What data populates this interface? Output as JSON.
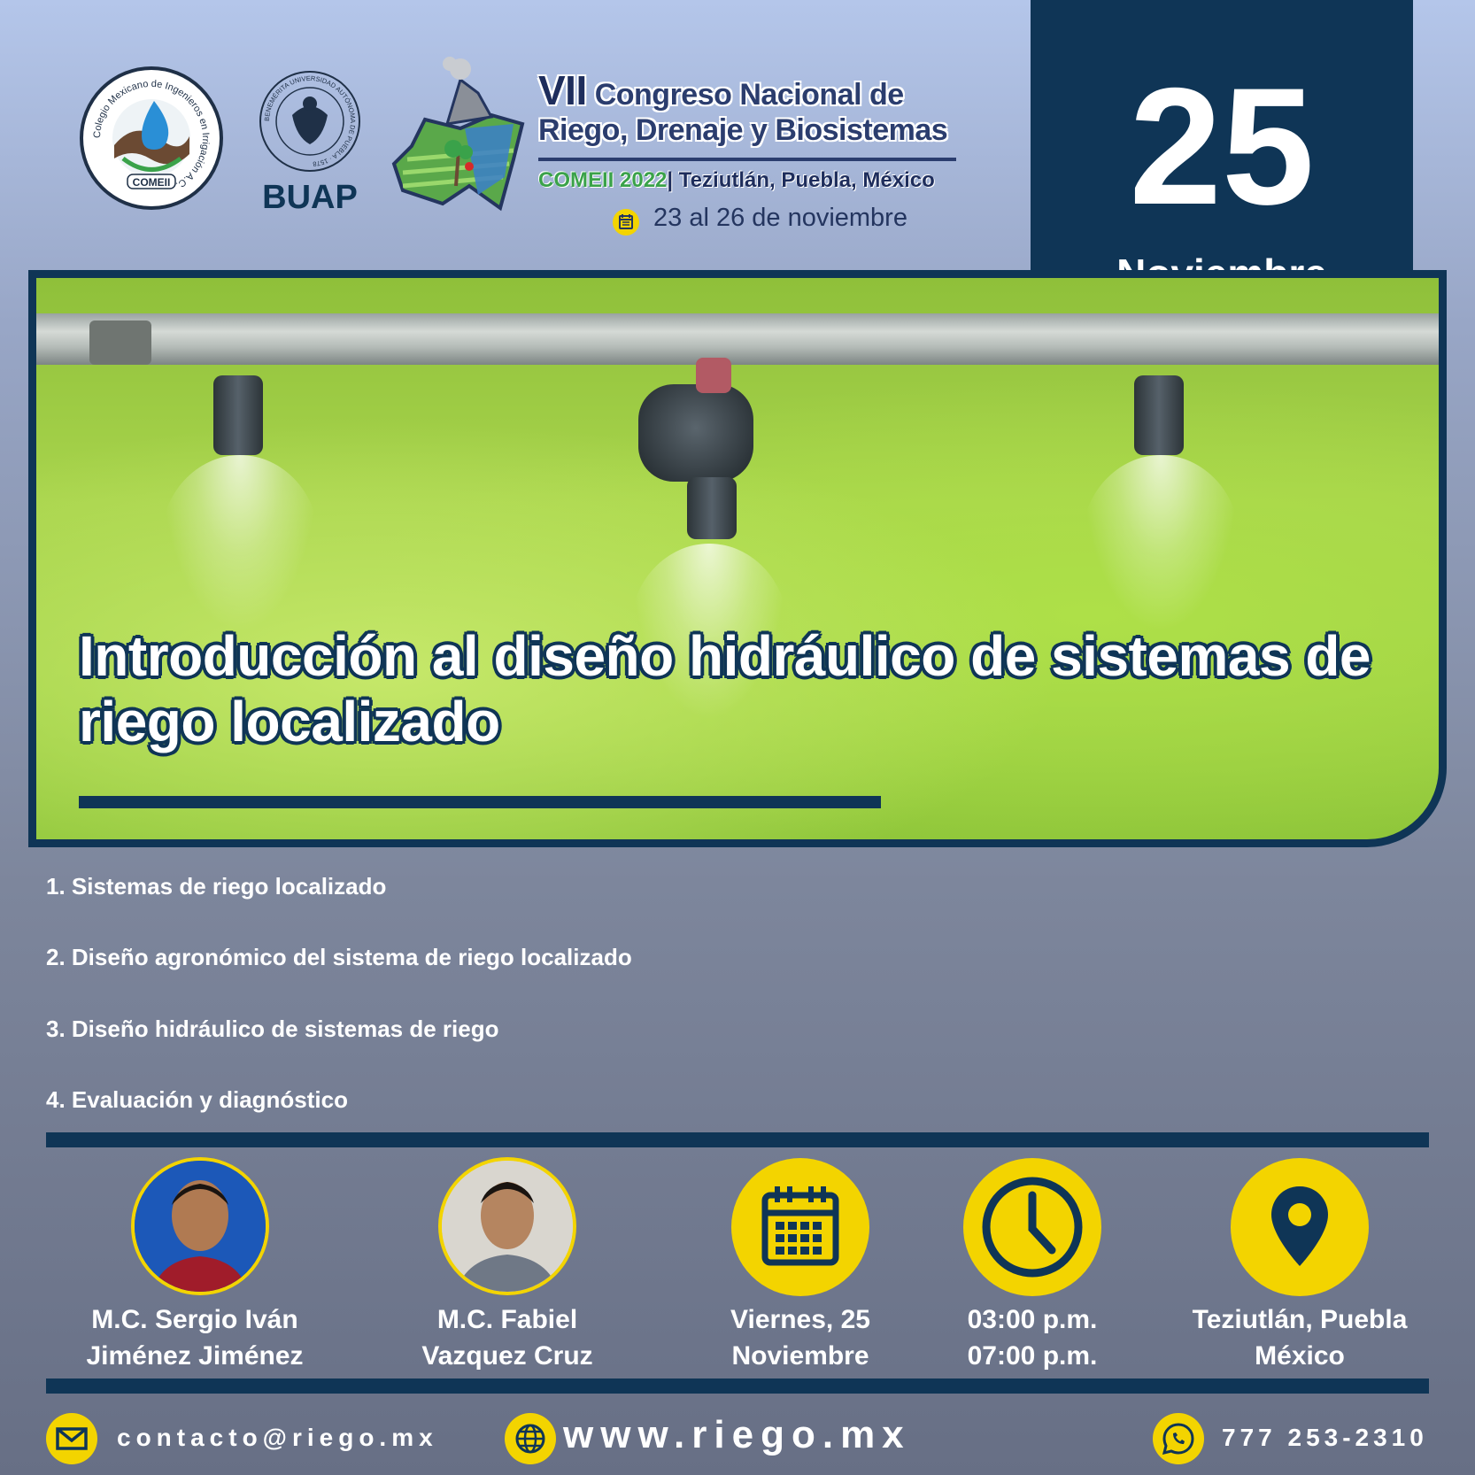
{
  "header": {
    "comeii_logo": {
      "ring_text": "Colegio Mexicano de Ingenieros en Irrigación A.C.",
      "label": "COMEII"
    },
    "buap_logo": {
      "ring_text": "BENEMÉRITA UNIVERSIDAD AUTÓNOMA DE PUEBLA · 1578",
      "label": "BUAP"
    },
    "congress": {
      "edition": "VII",
      "title_line1": "Congreso Nacional de",
      "title_line2": "Riego, Drenaje y Biosistemas",
      "edition_label": "COMEII 2022",
      "separator": "|",
      "place": "Teziutlán, Puebla, México",
      "dates": "23 al 26 de noviembre"
    }
  },
  "banner": {
    "day": "25",
    "month": "Noviembre"
  },
  "course": {
    "title_line1": "Introducción al diseño hidráulico de sistemas de",
    "title_line2": "riego localizado"
  },
  "topics": [
    "1. Sistemas de riego localizado",
    "2. Diseño agronómico del sistema de riego localizado",
    "3. Diseño hidráulico de sistemas de riego",
    "4. Evaluación y diagnóstico"
  ],
  "speakers": [
    {
      "line1": "M.C. Sergio Iván",
      "line2": "Jiménez Jiménez"
    },
    {
      "line1": "M.C. Fabiel",
      "line2": "Vazquez Cruz"
    }
  ],
  "details": {
    "date": {
      "line1": "Viernes, 25",
      "line2": "Noviembre"
    },
    "time": {
      "line1": "03:00 p.m.",
      "line2": "07:00 p.m."
    },
    "location": {
      "line1": "Teziutlán, Puebla",
      "line2": "México"
    }
  },
  "footer": {
    "email": "contacto@riego.mx",
    "website": "www.riego.mx",
    "phone": "777 253-2310"
  },
  "colors": {
    "navy": "#0f3556",
    "yellow": "#f3d400",
    "congress_blue": "#2b3d6e",
    "congress_green": "#3aa24a"
  },
  "icons": [
    "calendar-icon",
    "clock-icon",
    "location-pin-icon",
    "envelope-icon",
    "globe-icon",
    "whatsapp-icon"
  ]
}
